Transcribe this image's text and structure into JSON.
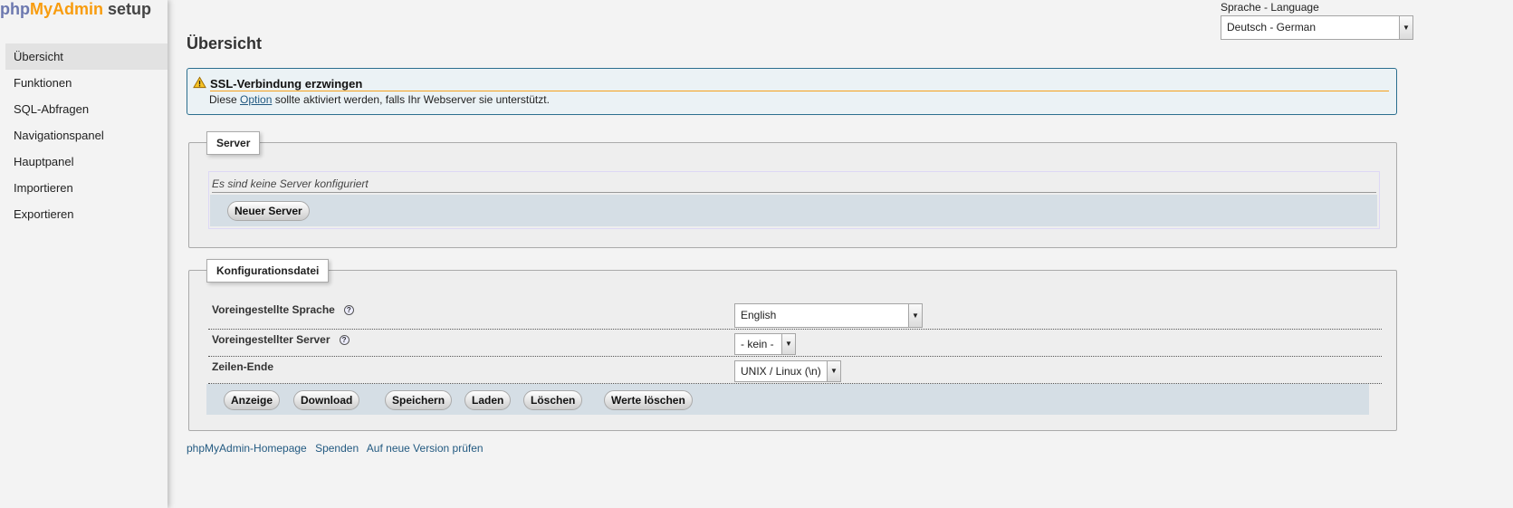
{
  "logo": {
    "php": "php",
    "myadmin": "MyAdmin",
    "setup": "setup"
  },
  "sidebar": {
    "items": [
      {
        "label": "Übersicht",
        "active": true
      },
      {
        "label": "Funktionen"
      },
      {
        "label": "SQL-Abfragen"
      },
      {
        "label": "Navigationspanel"
      },
      {
        "label": "Hauptpanel"
      },
      {
        "label": "Importieren"
      },
      {
        "label": "Exportieren"
      }
    ]
  },
  "page": {
    "title": "Übersicht"
  },
  "language": {
    "label": "Sprache - Language",
    "selected": "Deutsch - German"
  },
  "notice": {
    "title": "SSL-Verbindung erzwingen",
    "text_before": "Diese ",
    "link": "Option",
    "text_after": " sollte aktiviert werden, falls Ihr Webserver sie unterstützt."
  },
  "server_section": {
    "legend": "Server",
    "empty_text": "Es sind keine Server konfiguriert",
    "new_server_button": "Neuer Server"
  },
  "config_section": {
    "legend": "Konfigurationsdatei",
    "rows": [
      {
        "label": "Voreingestellte Sprache",
        "value": "English",
        "help": "?"
      },
      {
        "label": "Voreingestellter Server",
        "value": "- kein -",
        "help": "?"
      },
      {
        "label": "Zeilen-Ende",
        "value": "UNIX / Linux (\\n)"
      }
    ],
    "buttons": {
      "display": "Anzeige",
      "download": "Download",
      "save": "Speichern",
      "load": "Laden",
      "delete": "Löschen",
      "clear": "Werte löschen"
    }
  },
  "footer": {
    "homepage": "phpMyAdmin-Homepage",
    "donate": "Spenden",
    "check_version": "Auf neue Version prüfen"
  },
  "colors": {
    "accent_orange": "#f89c0e",
    "accent_purple": "#6c78af",
    "link": "#235a81",
    "notice_border": "#2b6e8e"
  }
}
